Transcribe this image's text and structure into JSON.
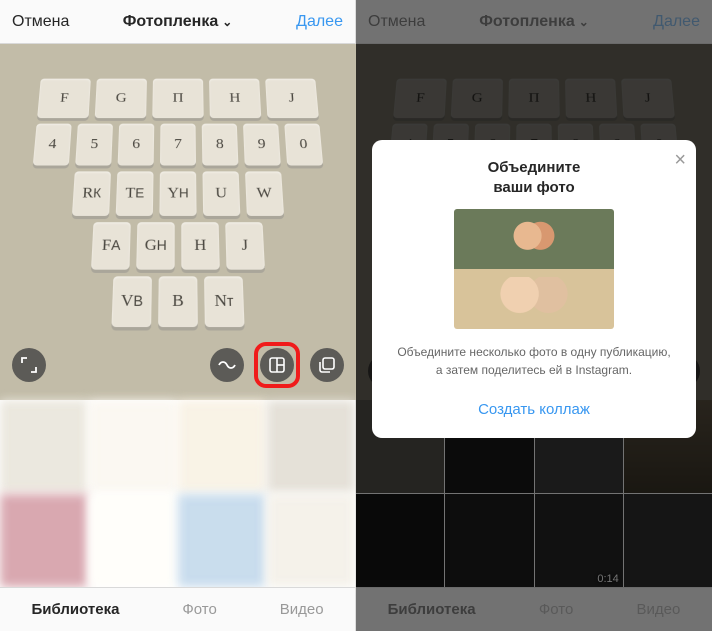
{
  "left": {
    "topbar": {
      "cancel": "Отмена",
      "title": "Фотопленка",
      "next": "Далее"
    },
    "controls": {
      "expand": "expand-icon",
      "infinity": "boomerang-icon",
      "layout": "layout-icon",
      "multi": "multi-select-icon"
    },
    "bottombar": {
      "library": "Библиотека",
      "photo": "Фото",
      "video": "Видео"
    }
  },
  "right": {
    "topbar": {
      "cancel": "Отмена",
      "title": "Фотопленка",
      "next": "Далее"
    },
    "dialog": {
      "title_l1": "Объедините",
      "title_l2": "ваши фото",
      "desc": "Объедините несколько фото в одну публикацию, а затем поделитесь ей в Instagram.",
      "action": "Создать коллаж"
    },
    "thumbs": {
      "video_duration": "0:14"
    },
    "bottombar": {
      "library": "Библиотека",
      "photo": "Фото",
      "video": "Видео"
    }
  },
  "keys": {
    "r1": [
      "F",
      "G",
      "H",
      "J"
    ],
    "r2": [
      "4",
      "5",
      "6",
      "7",
      "8",
      "9",
      "0"
    ],
    "r3": [
      "К",
      "Т",
      "Е",
      "У",
      "Н",
      "W"
    ],
    "r4": [
      "F",
      "А",
      "G Н",
      "J"
    ],
    "r5": [
      "V",
      "В",
      "N т"
    ]
  }
}
